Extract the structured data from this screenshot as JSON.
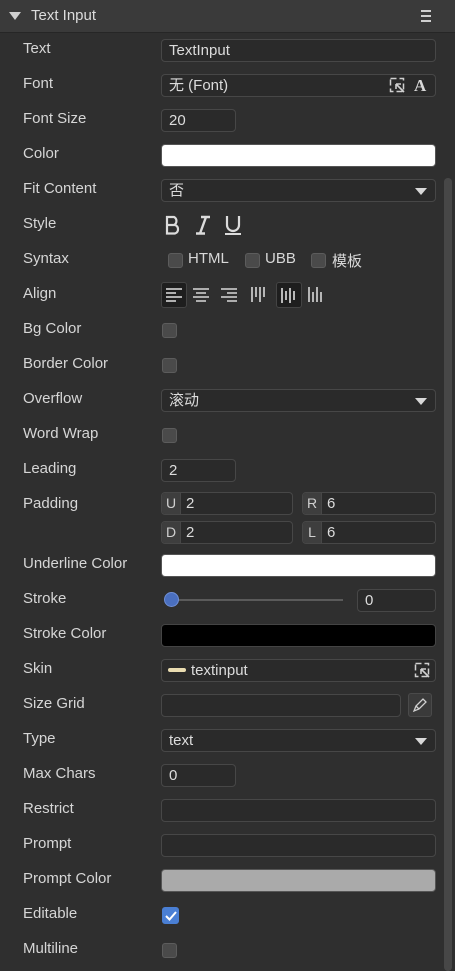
{
  "panel": {
    "title": "Text Input"
  },
  "props": {
    "text": {
      "label": "Text",
      "value": "TextInput"
    },
    "font": {
      "label": "Font",
      "value": "无 (Font)"
    },
    "font_size": {
      "label": "Font Size",
      "value": "20"
    },
    "color": {
      "label": "Color",
      "swatch": "#ffffff"
    },
    "fit_content": {
      "label": "Fit Content",
      "value": "否"
    },
    "style": {
      "label": "Style"
    },
    "syntax": {
      "label": "Syntax",
      "options": [
        "HTML",
        "UBB",
        "模板"
      ]
    },
    "align": {
      "label": "Align"
    },
    "bg_color": {
      "label": "Bg Color"
    },
    "border_color": {
      "label": "Border Color"
    },
    "overflow": {
      "label": "Overflow",
      "value": "滚动"
    },
    "word_wrap": {
      "label": "Word Wrap"
    },
    "leading": {
      "label": "Leading",
      "value": "2"
    },
    "padding": {
      "label": "Padding",
      "u": "2",
      "r": "6",
      "d": "2",
      "l": "6",
      "u_prefix": "U",
      "r_prefix": "R",
      "d_prefix": "D",
      "l_prefix": "L"
    },
    "underline_color": {
      "label": "Underline Color",
      "swatch": "#ffffff"
    },
    "stroke": {
      "label": "Stroke",
      "value": "0"
    },
    "stroke_color": {
      "label": "Stroke Color",
      "swatch": "#000000"
    },
    "skin": {
      "label": "Skin",
      "value": "textinput"
    },
    "size_grid": {
      "label": "Size Grid",
      "value": ""
    },
    "type": {
      "label": "Type",
      "value": "text"
    },
    "max_chars": {
      "label": "Max Chars",
      "value": "0"
    },
    "restrict": {
      "label": "Restrict",
      "value": ""
    },
    "prompt": {
      "label": "Prompt",
      "value": ""
    },
    "prompt_color": {
      "label": "Prompt Color",
      "swatch": "#aaaaaa"
    },
    "editable": {
      "label": "Editable",
      "checked": true
    },
    "multiline": {
      "label": "Multiline",
      "checked": false
    }
  },
  "colors": {
    "accent": "#4a7fd4",
    "background": "#2f2f2f",
    "field": "#2a2a2a"
  }
}
